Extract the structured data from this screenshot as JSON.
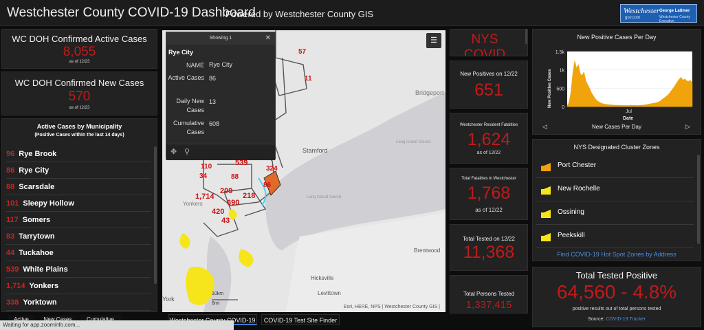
{
  "header": {
    "title": "Westchester County COVID-19 Dashboard",
    "subtitle": "Powered by Westchester County GIS",
    "logo_text_1": "Westchester",
    "logo_text_2": "gov.com",
    "logo_text_3": "George Latimer",
    "logo_text_4": "Westchester County Executive"
  },
  "left": {
    "active_cases": {
      "title": "WC DOH Confirmed Active Cases",
      "value": "8,055",
      "asof": "as of 12/23"
    },
    "new_cases": {
      "title": "WC DOH Confirmed New Cases",
      "value": "570",
      "asof": "as of 12/23"
    },
    "list": {
      "title": "Active Cases by Municipality",
      "subtitle": "(Positive Cases within the last 14 days)",
      "items": [
        {
          "count": "96",
          "name": "Rye Brook"
        },
        {
          "count": "86",
          "name": "Rye City"
        },
        {
          "count": "88",
          "name": "Scarsdale"
        },
        {
          "count": "101",
          "name": "Sleepy Hollow"
        },
        {
          "count": "117",
          "name": "Somers"
        },
        {
          "count": "83",
          "name": "Tarrytown"
        },
        {
          "count": "44",
          "name": "Tuckahoe"
        },
        {
          "count": "539",
          "name": "White Plains"
        },
        {
          "count": "1,714",
          "name": "Yonkers"
        },
        {
          "count": "338",
          "name": "Yorktown"
        }
      ]
    },
    "tabs": [
      "Active",
      "New Cases",
      "Cumulative"
    ]
  },
  "popup": {
    "header": "Showing 1",
    "title": "Rye City",
    "fields": [
      {
        "k": "NAME",
        "v": "Rye City"
      },
      {
        "k": "Active Cases",
        "v": "86"
      },
      {
        "k": "Daily New Cases",
        "v": "13"
      },
      {
        "k": "Cumulative Cases",
        "v": "608"
      }
    ]
  },
  "map": {
    "labels": [
      "Bridgeport",
      "Stamford",
      "Long Island Sound",
      "Long Island Sound",
      "Hicksville",
      "Levittown",
      "Brentwood",
      "Yonkers",
      "York"
    ],
    "numbers": [
      "57",
      "11",
      "110",
      "34",
      "539",
      "88",
      "324",
      "86",
      "209",
      "1,714",
      "690",
      "218",
      "420",
      "43"
    ],
    "scale_km": "10km",
    "scale_mi": "6mi",
    "attribution": "Esri, HERE, NPS | Westchester County GIS |",
    "tabs": [
      "Westchester County COVID-19",
      "COVID-19 Test Site Finder"
    ]
  },
  "middle": {
    "nys_title": "NYS COVID",
    "new_positives": {
      "title": "New Positives on 12/22",
      "value": "651"
    },
    "fatalities_resident": {
      "title": "Westchester Resident Fatalities",
      "value": "1,624",
      "asof": "as of 12/22"
    },
    "fatalities_total": {
      "title": "Total Fatalities in Westchester",
      "value": "1,768",
      "asof": "as of 12/22"
    },
    "tested": {
      "title": "Total Tested on 12/22",
      "value": "11,368"
    },
    "persons_tested": {
      "title": "Total Persons Tested",
      "value": "1,337,415"
    }
  },
  "chart": {
    "title": "New Positive Cases Per Day",
    "nav_label": "New Cases Per Day",
    "chart_data": {
      "type": "area",
      "title": "New Positive Cases Per Day",
      "xlabel": "Date",
      "ylabel": "New Positive Cases",
      "xticks": [
        "Jul"
      ],
      "yticks": [
        "0",
        "500",
        "1k",
        "1.5k"
      ],
      "ylim": [
        0,
        1500
      ],
      "values": [
        20,
        120,
        400,
        900,
        1250,
        1050,
        1150,
        900,
        850,
        950,
        700,
        600,
        500,
        380,
        300,
        220,
        160,
        130,
        100,
        80,
        70,
        60,
        55,
        50,
        45,
        40,
        40,
        35,
        35,
        35,
        30,
        30,
        30,
        30,
        30,
        35,
        35,
        30,
        30,
        35,
        40,
        45,
        50,
        60,
        70,
        80,
        90,
        100,
        110,
        130,
        160,
        200,
        240,
        280,
        320,
        380,
        450,
        520,
        600,
        680,
        750,
        800,
        720,
        760,
        700,
        690,
        720,
        640
      ],
      "color": "#f0a30a"
    }
  },
  "zones": {
    "title": "NYS Designated Cluster Zones",
    "items": [
      {
        "label": "Port Chester",
        "color": "#f0a30a"
      },
      {
        "label": "New Rochelle",
        "color": "#f0e000"
      },
      {
        "label": "Ossining",
        "color": "#f0e000"
      },
      {
        "label": "Peekskill",
        "color": "#f0e000"
      }
    ],
    "link": "Find COVID-19 Hot Spot Zones by Address"
  },
  "positive": {
    "title": "Total Tested Positive",
    "value": "64,560 - 4.8%",
    "sub": "positive results out of total persons tested",
    "source_label": "Source:",
    "source_link": "COVID-19 Tracker"
  },
  "statusbar": "Waiting for app.zoominfo.com..."
}
